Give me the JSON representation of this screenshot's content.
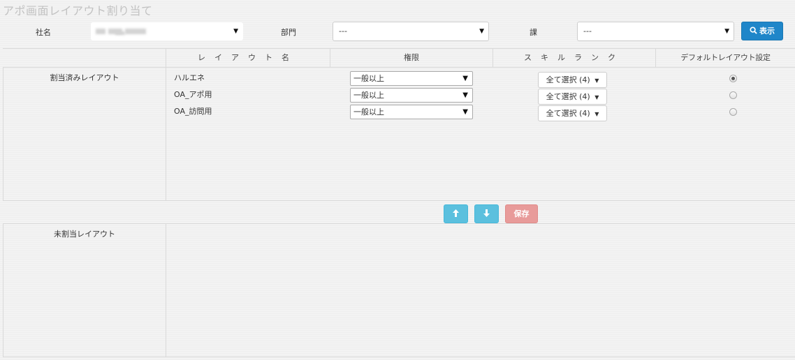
{
  "page": {
    "title": "アポ画面レイアウト割り当て"
  },
  "filters": {
    "company_label": "社名",
    "company_value": "",
    "department_label": "部門",
    "department_value": "---",
    "section_label": "課",
    "section_value": "---",
    "search_icon": "search-icon",
    "search_label": "表示"
  },
  "columns": {
    "layout_name": "レイアウト名",
    "permission": "権限",
    "skill_rank": "スキルランク",
    "default_setting": "デフォルトレイアウト設定"
  },
  "assigned": {
    "label": "割当済みレイアウト",
    "rows": [
      {
        "name": "ハルエネ",
        "permission": "一般以上",
        "skill": "全て選択 (4)",
        "default": true
      },
      {
        "name": "OA_アポ用",
        "permission": "一般以上",
        "skill": "全て選択 (4)",
        "default": false
      },
      {
        "name": "OA_訪問用",
        "permission": "一般以上",
        "skill": "全て選択 (4)",
        "default": false
      }
    ]
  },
  "actions": {
    "up_icon": "arrow-up-icon",
    "down_icon": "arrow-down-icon",
    "save_label": "保存"
  },
  "unassigned": {
    "label": "未割当レイアウト"
  },
  "colors": {
    "primary": "#1f86c9",
    "info": "#5bc0de",
    "danger_light": "#e89b9a",
    "title": "#c2c2c2",
    "border": "#d9d9d9"
  }
}
